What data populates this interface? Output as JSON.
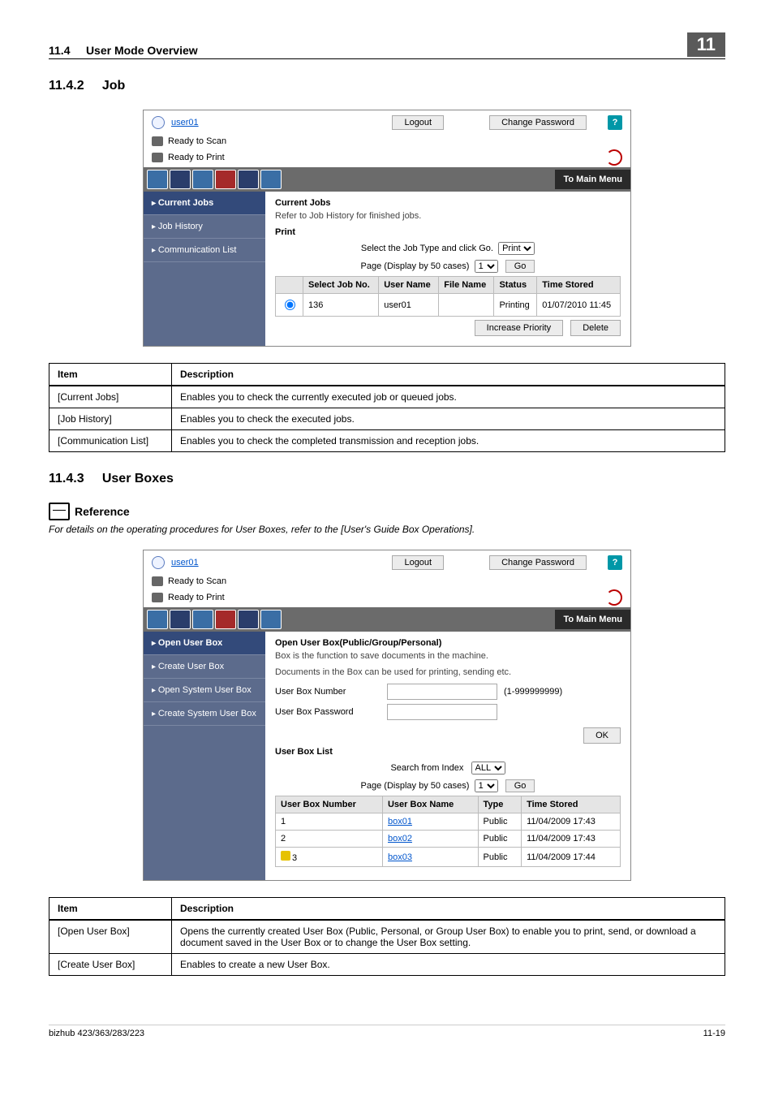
{
  "header": {
    "section_no": "11.4",
    "section_title": "User Mode Overview",
    "chapter": "11"
  },
  "sec1": {
    "num": "11.4.2",
    "title": "Job"
  },
  "shot1": {
    "user": "user01",
    "logout": "Logout",
    "change_pw": "Change Password",
    "ready_scan": "Ready to Scan",
    "ready_print": "Ready to Print",
    "to_main": "To Main Menu",
    "help_glyph": "?",
    "side": [
      "Current Jobs",
      "Job History",
      "Communication List"
    ],
    "side_selected": 0,
    "body_title": "Current Jobs",
    "body_inst": "Refer to Job History for finished jobs.",
    "print_label": "Print",
    "sel_line": "Select the Job Type and click Go.",
    "type_sel": "Print",
    "page_line": "Page (Display by 50 cases)",
    "page_sel": "1",
    "go": "Go",
    "cols": [
      "",
      "Select Job No.",
      "User Name",
      "File Name",
      "Status",
      "Time Stored"
    ],
    "rows": [
      [
        "",
        "136",
        "user01",
        "",
        "Printing",
        "01/07/2010 11:45"
      ]
    ],
    "btn_inc": "Increase Priority",
    "btn_del": "Delete"
  },
  "table1": {
    "head": [
      "Item",
      "Description"
    ],
    "rows": [
      [
        "[Current Jobs]",
        "Enables you to check the currently executed job or queued jobs."
      ],
      [
        "[Job History]",
        "Enables you to check the executed jobs."
      ],
      [
        "[Communication List]",
        "Enables you to check the completed transmission and reception jobs."
      ]
    ]
  },
  "sec2": {
    "num": "11.4.3",
    "title": "User Boxes"
  },
  "reference_label": "Reference",
  "reference_text": "For details on the operating procedures for User Boxes, refer to the [User's Guide Box Operations].",
  "shot2": {
    "user": "user01",
    "side": [
      "Open User Box",
      "Create User Box",
      "Open System User Box",
      "Create System User Box"
    ],
    "side_selected": 0,
    "body_title": "Open User Box(Public/Group/Personal)",
    "instr1": "Box is the function to save documents in the machine.",
    "instr2": "Documents in the Box can be used for printing, sending etc.",
    "fld_num": "User Box Number",
    "fld_num_hint": "(1-999999999)",
    "fld_pw": "User Box Password",
    "ok": "OK",
    "list_title": "User Box List",
    "search_line": "Search from Index",
    "search_sel": "ALL",
    "page_line": "Page (Display by 50 cases)",
    "page_sel": "1",
    "go": "Go",
    "cols": [
      "User Box Number",
      "User Box Name",
      "Type",
      "Time Stored"
    ],
    "rows": [
      [
        "1",
        "box01",
        "Public",
        "11/04/2009 17:43"
      ],
      [
        "2",
        "box02",
        "Public",
        "11/04/2009 17:43"
      ],
      [
        "3",
        "box03",
        "Public",
        "11/04/2009 17:44"
      ]
    ],
    "locked_row": 2
  },
  "table2": {
    "head": [
      "Item",
      "Description"
    ],
    "rows": [
      [
        "[Open User Box]",
        "Opens the currently created User Box (Public, Personal, or Group User Box) to enable you to print, send, or download a document saved in the User Box or to change the User Box setting."
      ],
      [
        "[Create User Box]",
        "Enables to create a new User Box."
      ]
    ]
  },
  "footer": {
    "model": "bizhub 423/363/283/223",
    "page": "11-19"
  }
}
